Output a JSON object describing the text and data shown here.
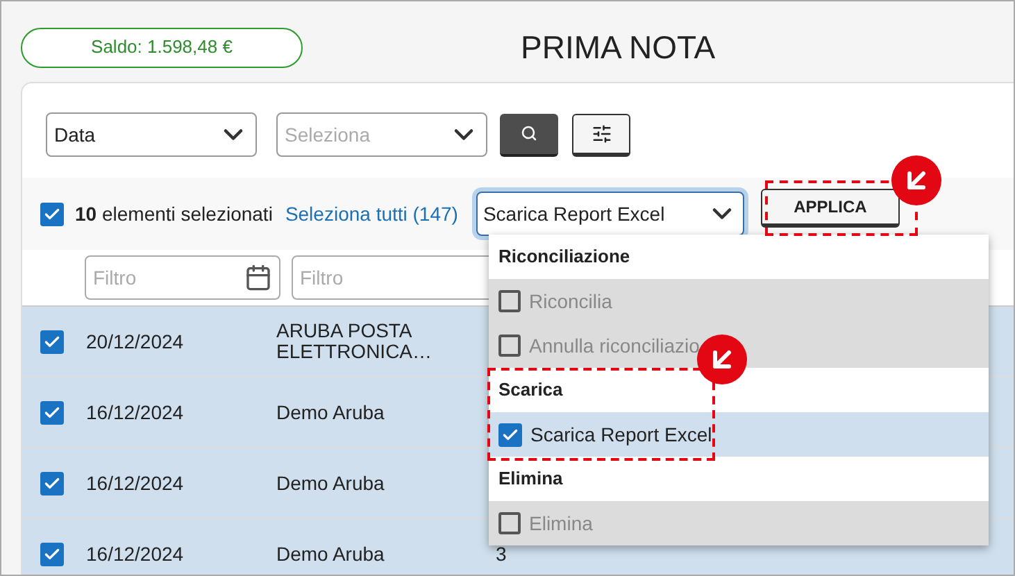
{
  "balance": "Saldo: 1.598,48 €",
  "title": "PRIMA NOTA",
  "filters": {
    "date_select": "Data",
    "select_placeholder": "Seleziona"
  },
  "selection": {
    "checked": true,
    "count": "10",
    "count_label": "elementi selezionati",
    "select_all_link": "Seleziona tutti (147)",
    "action_select": "Scarica Report Excel",
    "apply_button": "APPLICA"
  },
  "column_filters": [
    {
      "placeholder": "Filtro",
      "kind": "date"
    },
    {
      "placeholder": "Filtro",
      "kind": "text"
    }
  ],
  "rows": [
    {
      "selected": true,
      "date": "20/12/2024",
      "description": "ARUBA POSTA ELETTRONICA…"
    },
    {
      "selected": true,
      "date": "16/12/2024",
      "description": "Demo Aruba"
    },
    {
      "selected": true,
      "date": "16/12/2024",
      "description": "Demo Aruba"
    },
    {
      "selected": true,
      "date": "16/12/2024",
      "description": "Demo Aruba",
      "column_3": "3"
    }
  ],
  "menu": {
    "groups": [
      {
        "title": "Riconciliazione",
        "items": [
          {
            "label": "Riconcilia",
            "checked": false,
            "disabled": true
          },
          {
            "label": "Annulla riconciliazio",
            "checked": false,
            "disabled": true
          }
        ]
      },
      {
        "title": "Scarica",
        "items": [
          {
            "label": "Scarica Report Excel",
            "checked": true,
            "disabled": false
          }
        ]
      },
      {
        "title": "Elimina",
        "items": [
          {
            "label": "Elimina",
            "checked": false,
            "disabled": true
          }
        ]
      }
    ]
  }
}
